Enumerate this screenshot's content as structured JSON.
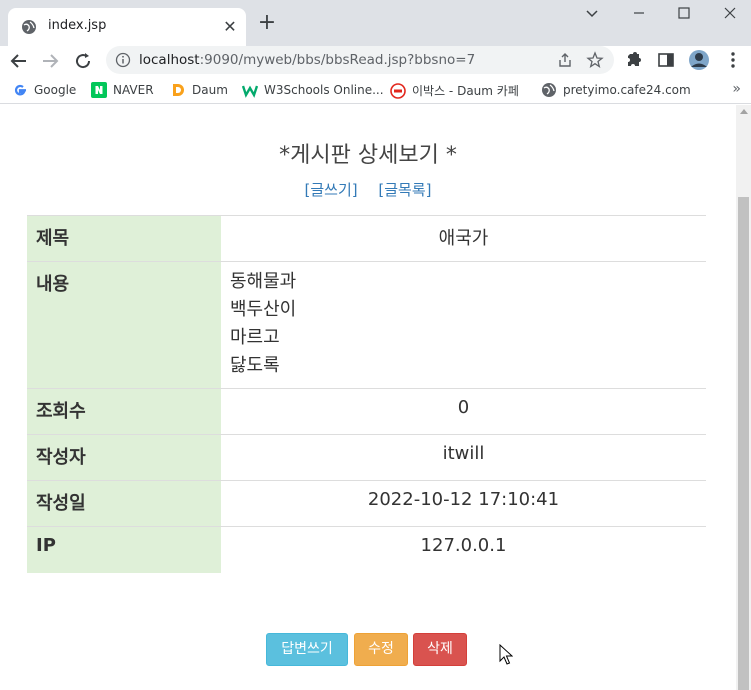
{
  "browser": {
    "tab_title": "index.jsp",
    "url_host": "localhost",
    "url_path": ":9090/myweb/bbs/bbsRead.jsp?bbsno=7",
    "bookmarks": [
      {
        "label": "Google",
        "icon": "google-icon"
      },
      {
        "label": "NAVER",
        "icon": "naver-icon"
      },
      {
        "label": "Daum",
        "icon": "daum-icon"
      },
      {
        "label": "W3Schools Online...",
        "icon": "w3schools-icon"
      },
      {
        "label": "이박스 - Daum 카페",
        "icon": "daum-cafe-icon"
      },
      {
        "label": "pretyimo.cafe24.com",
        "icon": "globe-icon"
      }
    ]
  },
  "page": {
    "title": "*게시판 상세보기 *",
    "link_write": "[글쓰기]",
    "link_list": "[글목록]",
    "rows": [
      {
        "label": "제목",
        "value": "애국가"
      },
      {
        "label": "내용",
        "value_lines": [
          "동해물과",
          "백두산이",
          "마르고",
          "닳도록"
        ]
      },
      {
        "label": "조회수",
        "value": "0"
      },
      {
        "label": "작성자",
        "value": "itwill"
      },
      {
        "label": "작성일",
        "value": "2022-10-12 17:10:41"
      },
      {
        "label": "IP",
        "value": "127.0.0.1"
      }
    ],
    "buttons": {
      "reply": "답변쓰기",
      "edit": "수정",
      "delete": "삭제"
    }
  },
  "colors": {
    "label_bg": "#dff0d8",
    "reply_btn": "#5bc0de",
    "edit_btn": "#f0ad4e",
    "delete_btn": "#d9534f",
    "link": "#337ab7"
  }
}
